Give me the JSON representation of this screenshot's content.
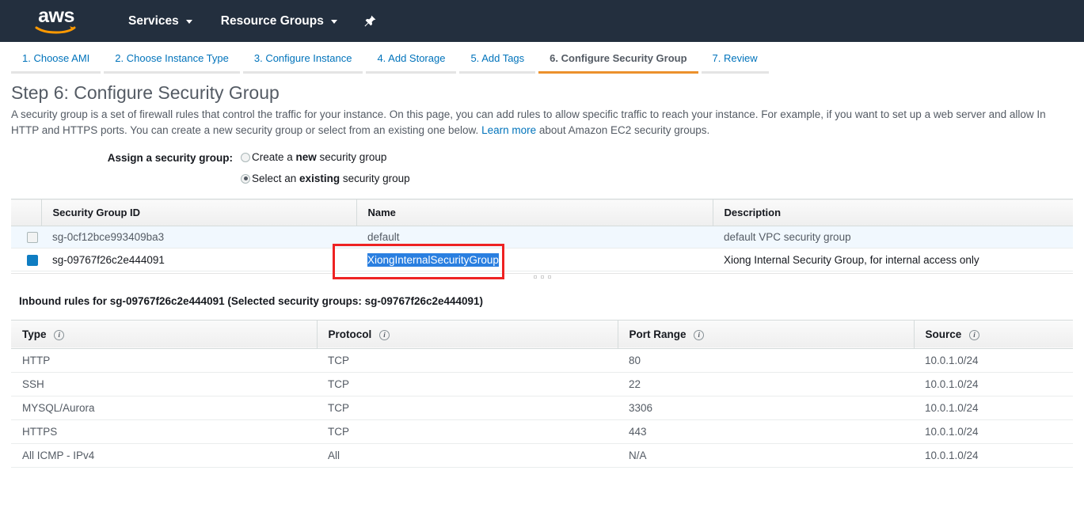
{
  "topnav": {
    "logo_text": "aws",
    "logo_alt": "aws-logo",
    "items": [
      {
        "label": "Services"
      },
      {
        "label": "Resource Groups"
      }
    ],
    "pin_label": "pin"
  },
  "steps": [
    {
      "label": "1. Choose AMI",
      "active": false
    },
    {
      "label": "2. Choose Instance Type",
      "active": false
    },
    {
      "label": "3. Configure Instance",
      "active": false
    },
    {
      "label": "4. Add Storage",
      "active": false
    },
    {
      "label": "5. Add Tags",
      "active": false
    },
    {
      "label": "6. Configure Security Group",
      "active": true
    },
    {
      "label": "7. Review",
      "active": false
    }
  ],
  "page": {
    "title": "Step 6: Configure Security Group",
    "desc_line1_a": "A security group is a set of firewall rules that control the traffic for your instance. On this page, you can add rules to allow specific traffic to reach your instance. For example, if you want to set up a web server and allow In",
    "desc_line2_a": "HTTP and HTTPS ports. You can create a new security group or select from an existing one below.",
    "desc_link": "Learn more",
    "desc_line2_b": "about Amazon EC2 security groups."
  },
  "assign": {
    "label": "Assign a security group:",
    "options": [
      {
        "pre": "Create a ",
        "bold": "new",
        "post": " security group",
        "checked": false
      },
      {
        "pre": "Select an ",
        "bold": "existing",
        "post": " security group",
        "checked": true
      }
    ]
  },
  "sg_table": {
    "columns": [
      "Security Group ID",
      "Name",
      "Description"
    ],
    "rows": [
      {
        "checked": false,
        "id": "sg-0cf12bce993409ba3",
        "name": "default",
        "name_selected": false,
        "description": "default VPC security group"
      },
      {
        "checked": true,
        "id": "sg-09767f26c2e444091",
        "name": "XiongInternalSecurityGroup",
        "name_selected": true,
        "description": "Xiong Internal Security Group, for internal access only"
      }
    ]
  },
  "inbound": {
    "caption": "Inbound rules for sg-09767f26c2e444091 (Selected security groups: sg-09767f26c2e444091)",
    "columns": [
      "Type",
      "Protocol",
      "Port Range",
      "Source"
    ],
    "rows": [
      {
        "type": "HTTP",
        "protocol": "TCP",
        "port": "80",
        "source": "10.0.1.0/24"
      },
      {
        "type": "SSH",
        "protocol": "TCP",
        "port": "22",
        "source": "10.0.1.0/24"
      },
      {
        "type": "MYSQL/Aurora",
        "protocol": "TCP",
        "port": "3306",
        "source": "10.0.1.0/24"
      },
      {
        "type": "HTTPS",
        "protocol": "TCP",
        "port": "443",
        "source": "10.0.1.0/24"
      },
      {
        "type": "All ICMP - IPv4",
        "protocol": "All",
        "port": "N/A",
        "source": "10.0.1.0/24"
      }
    ]
  },
  "colors": {
    "nav_bg": "#232f3e",
    "accent_orange": "#ec912d",
    "link_blue": "#0073bb",
    "selection_blue": "#2a7fe0",
    "annotation_red": "#ee2222",
    "checkbox_blue": "#0f7dc2"
  },
  "annotation": {
    "shape": "red-rectangle",
    "target": "XiongInternalSecurityGroup"
  }
}
